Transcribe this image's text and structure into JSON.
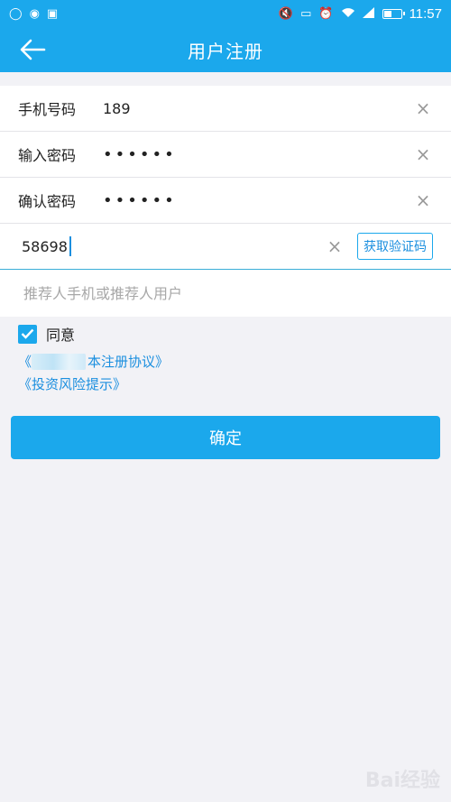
{
  "status_bar": {
    "time": "11:57",
    "left_icons": [
      "qq-icon",
      "app-notification-icon",
      "image-icon"
    ],
    "right_icons": [
      "mute-icon",
      "vibrate-off-icon",
      "alarm-icon",
      "wifi-icon",
      "signal-icon",
      "battery-icon"
    ],
    "battery_level_fraction": 0.45
  },
  "app_bar": {
    "title": "用户注册",
    "back_icon": "arrow-left-icon"
  },
  "form": {
    "phone": {
      "label": "手机号码",
      "value": "189"
    },
    "password": {
      "label": "输入密码",
      "value": "••••••"
    },
    "confirm_password": {
      "label": "确认密码",
      "value": "••••••"
    },
    "verification": {
      "value": "58698",
      "get_code_label": "获取验证码"
    },
    "referrer": {
      "placeholder": "推荐人手机或推荐人用户"
    },
    "clear_icon": "×"
  },
  "agreement": {
    "checked": true,
    "label": "同意",
    "link1_visible_text": "本注册协议》",
    "link1_prefix": "《",
    "link2": "《投资风险提示》"
  },
  "confirm_button": {
    "label": "确定"
  },
  "watermark": {
    "text": "Bai经验"
  },
  "colors": {
    "primary": "#1ba8ec",
    "link": "#1b8fdf",
    "background": "#f2f2f6"
  }
}
